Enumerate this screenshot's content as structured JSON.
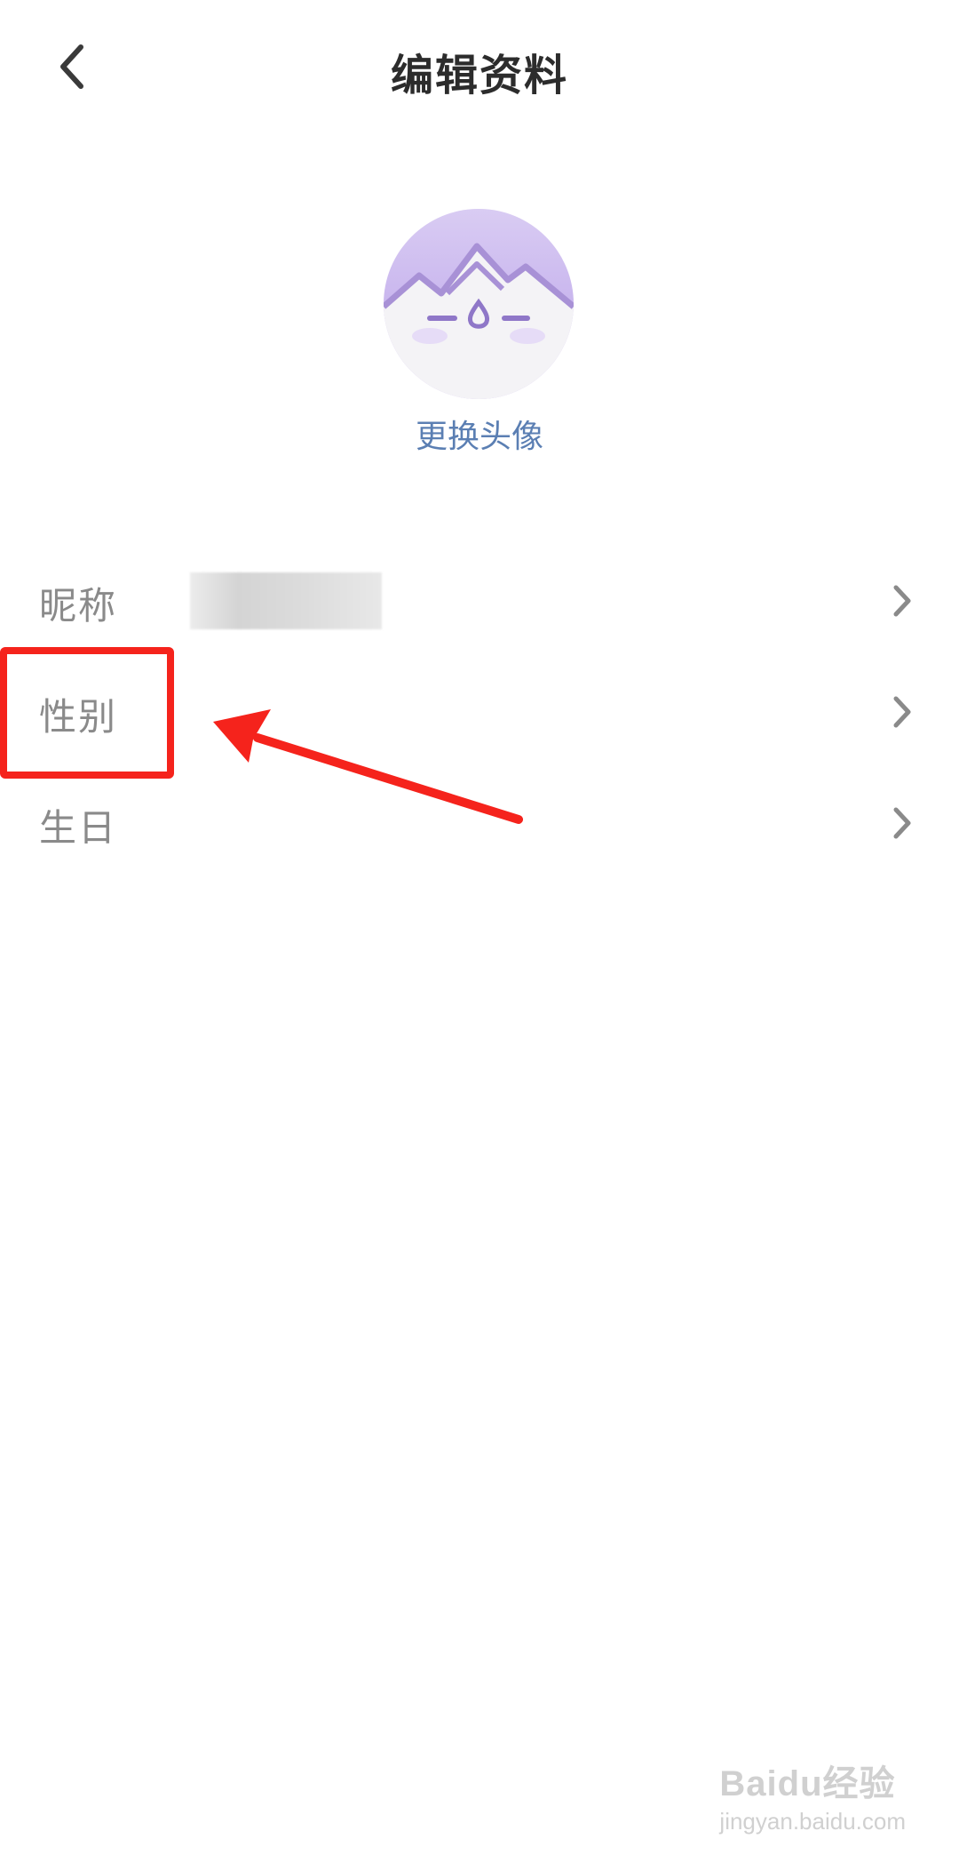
{
  "header": {
    "title": "编辑资料"
  },
  "avatar": {
    "change_label": "更换头像"
  },
  "rows": [
    {
      "label": "昵称"
    },
    {
      "label": "性别"
    },
    {
      "label": "生日"
    }
  ],
  "watermark": {
    "logo": "Baidu经验",
    "url": "jingyan.baidu.com"
  },
  "colors": {
    "annotation": "#f5231c",
    "link": "#5b7fb3",
    "avatar_accent": "#a891d6"
  }
}
